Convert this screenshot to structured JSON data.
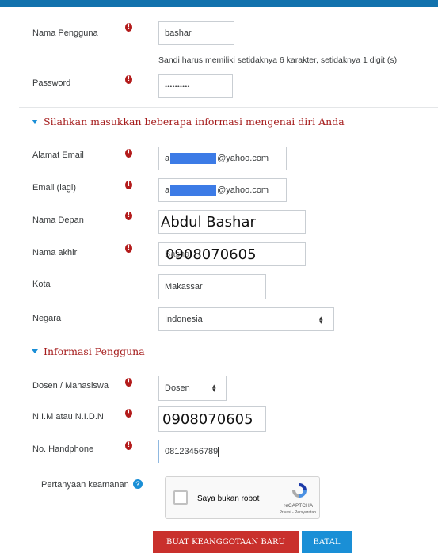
{
  "form": {
    "username": {
      "label": "Nama Pengguna",
      "value": "bashar"
    },
    "password": {
      "help": "Sandi harus memiliki setidaknya 6 karakter, setidaknya 1 digit (s)",
      "label": "Password",
      "value": "••••••••••"
    },
    "section_personal": "Silahkan masukkan beberapa informasi mengenai diri Anda",
    "email": {
      "label": "Alamat Email",
      "prefix": "a",
      "suffix": "@yahoo.com"
    },
    "email2": {
      "label": "Email (lagi)",
      "prefix": "a",
      "suffix": "@yahoo.com"
    },
    "firstname": {
      "label": "Nama Depan",
      "value": "Abdul Bashar"
    },
    "lastname": {
      "label": "Nama akhir",
      "value": "Bashar",
      "overlay": "0908070605"
    },
    "city": {
      "label": "Kota",
      "value": "Makassar"
    },
    "country": {
      "label": "Negara",
      "value": "Indonesia"
    },
    "section_user": "Informasi Pengguna",
    "role": {
      "label": "Dosen / Mahasiswa",
      "value": "Dosen"
    },
    "nim": {
      "label": "N.I.M atau N.I.D.N",
      "value": "0908070605"
    },
    "phone": {
      "label": "No. Handphone",
      "value": "08123456789"
    },
    "security": {
      "label": "Pertanyaan keamanan"
    },
    "recaptcha": {
      "checkbox_label": "Saya bukan robot",
      "brand": "reCAPTCHA",
      "links": "Privasi - Persyaratan"
    },
    "buttons": {
      "submit": "BUAT KEANGGOTAAN BARU",
      "cancel": "BATAL"
    }
  },
  "colors": {
    "accent": "#1272ad",
    "required": "#b31b1b",
    "section": "#a51c1c",
    "submit": "#c9302c",
    "cancel": "#1a8fd6"
  }
}
